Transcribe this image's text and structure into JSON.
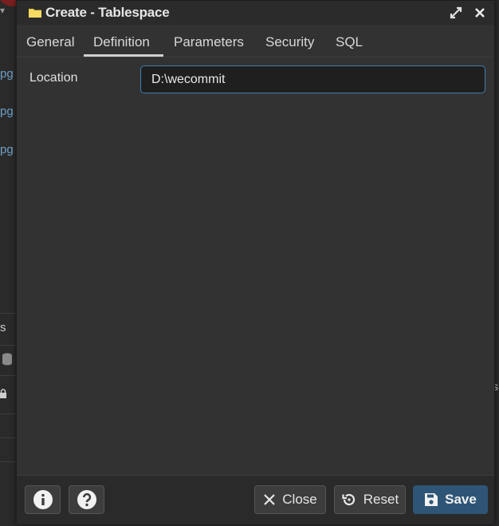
{
  "window": {
    "title": "Create - Tablespace"
  },
  "tabs": [
    {
      "label": "General",
      "active": false
    },
    {
      "label": "Definition",
      "active": true
    },
    {
      "label": "Parameters",
      "active": false
    },
    {
      "label": "Security",
      "active": false
    },
    {
      "label": "SQL",
      "active": false
    }
  ],
  "form": {
    "location_label": "Location",
    "location_value": "D:\\wecommit"
  },
  "footer": {
    "close_label": "Close",
    "reset_label": "Reset",
    "save_label": "Save"
  },
  "background": {
    "link_fragments": [
      "pg",
      "pg",
      "pg"
    ],
    "left_letter": "s",
    "right_letter": "s"
  },
  "colors": {
    "dialog_bg": "#323232",
    "accent": "#3f7fb0",
    "save_bg": "#2e5576",
    "folder_icon": "#f3d24f"
  },
  "icons": {
    "title": "folder-icon",
    "expand": "expand-icon",
    "close": "close-icon",
    "info": "info-icon",
    "help": "help-icon",
    "close_button": "x-icon",
    "reset_button": "reset-icon",
    "save_button": "save-icon"
  }
}
